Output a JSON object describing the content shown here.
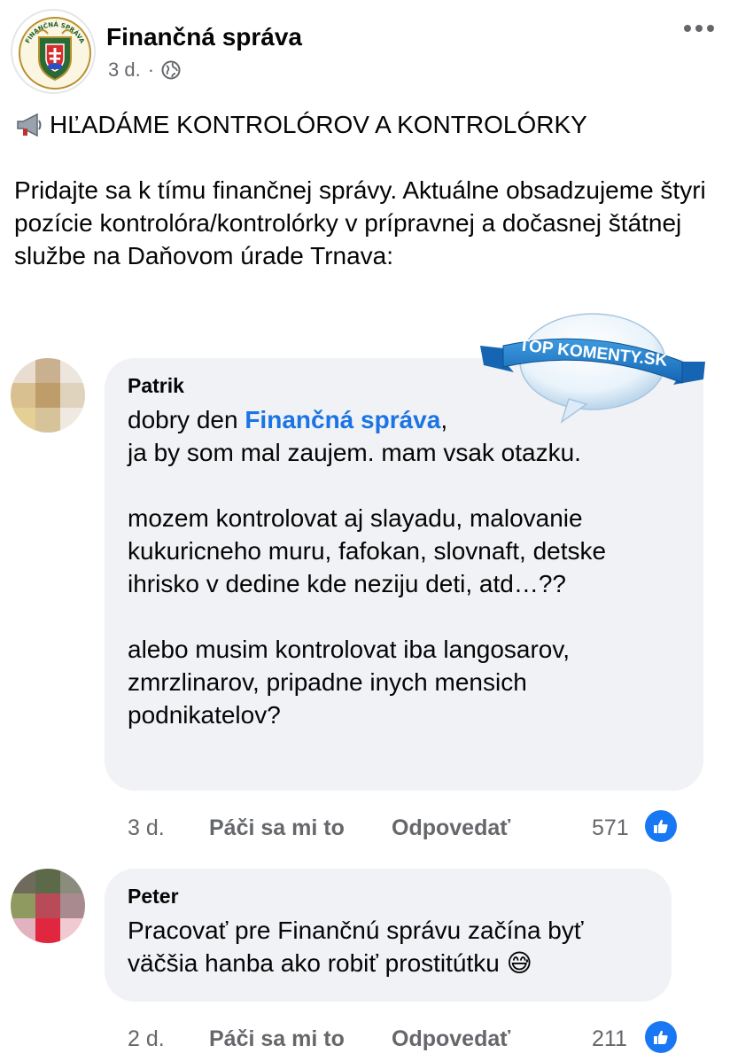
{
  "post": {
    "page_name": "Finančná správa",
    "time": "3 d.",
    "separator": "·",
    "logo_text": "FINANČNÁ SPRÁVA",
    "title": "HĽADÁME KONTROLÓROV A KONTROLÓRKY",
    "body": "Pridajte sa k tímu finančnej správy. Aktuálne obsadzujeme štyri pozície kontrolóra/kontrolórky v prípravnej a dočasnej štátnej službe na Daňovom úrade Trnava:"
  },
  "badge": {
    "text": "TOP KOMENTY.SK"
  },
  "comments": [
    {
      "author": "Patrik",
      "line1_prefix": "dobry den ",
      "mention": "Finančná správa",
      "line1_suffix": ",",
      "line2": "ja by som mal zaujem. mam vsak otazku.",
      "para2": "mozem kontrolovat aj slayadu, malovanie kukuricneho muru, fafokan, slovnaft, detske ihrisko v dedine kde neziju deti, atd…??",
      "para3": "alebo musim kontrolovat iba langosarov, zmrzlinarov, pripadne inych mensich podnikatelov?",
      "time": "3 d.",
      "like_label": "Páči sa mi to",
      "reply_label": "Odpovedať",
      "likes": "571"
    },
    {
      "author": "Peter",
      "text": "Pracovať pre Finančnú správu začína byť väčšia hanba ako robiť prostitútku",
      "emoji": "😅",
      "time": "2 d.",
      "like_label": "Páči sa mi to",
      "reply_label": "Odpovedať",
      "likes": "211"
    }
  ],
  "colors": {
    "link": "#1b74e4",
    "like_blue": "#1877f2",
    "bubble_bg": "#f0f2f5",
    "meta_gray": "#65676b"
  },
  "icons": [
    "megaphone-icon",
    "globe-icon",
    "more-icon",
    "like-icon"
  ]
}
